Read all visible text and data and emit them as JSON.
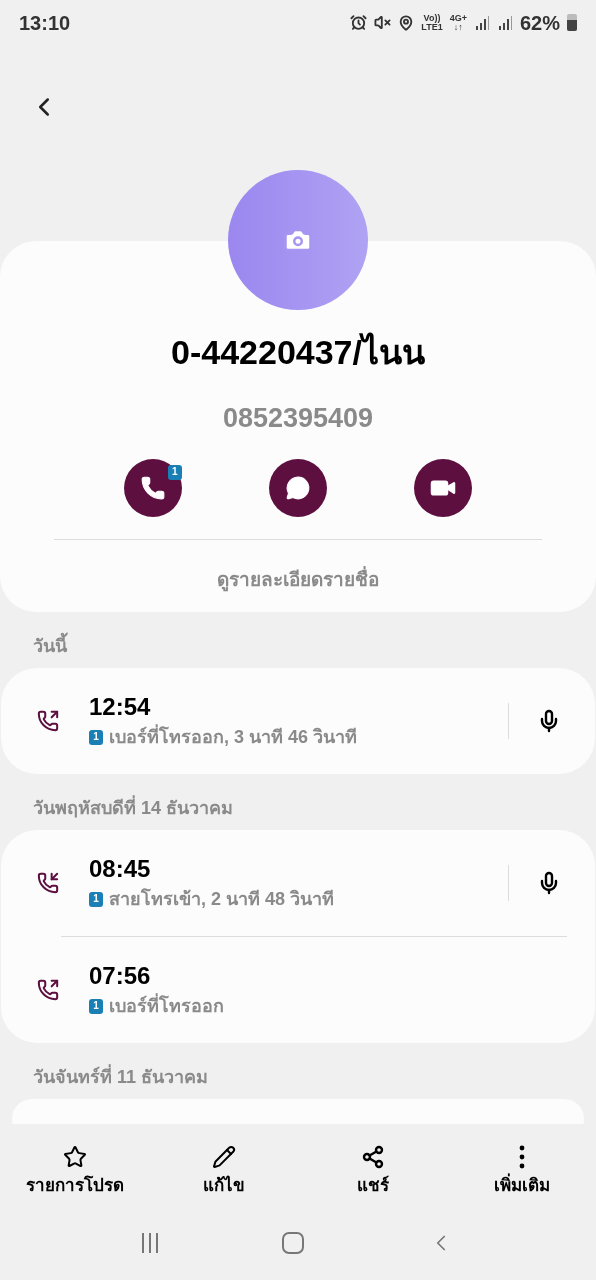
{
  "status_bar": {
    "time": "13:10",
    "volte": "Vo))",
    "lte": "LTE1",
    "network": "4G+",
    "data_arrows": "↓↑",
    "battery": "62%"
  },
  "contact": {
    "name": "0-44220437/ไนน",
    "number": "0852395409",
    "call_sim_badge": "1",
    "details_link": "ดูรายละเอียดรายชื่อ"
  },
  "groups": [
    {
      "date": "วันนี้",
      "calls": [
        {
          "kind": "outgoing",
          "time": "12:54",
          "sim": "1",
          "detail": "เบอร์ที่โทรออก, 3 นาที 46 วินาที",
          "recording": true
        }
      ]
    },
    {
      "date": "วันพฤหัสบดีที่ 14 ธันวาคม",
      "calls": [
        {
          "kind": "incoming",
          "time": "08:45",
          "sim": "1",
          "detail": "สายโทรเข้า, 2 นาที 48 วินาที",
          "recording": true
        },
        {
          "kind": "outgoing",
          "time": "07:56",
          "sim": "1",
          "detail": "เบอร์ที่โทรออก",
          "recording": false
        }
      ]
    },
    {
      "date": "วันจันทร์ที่ 11 ธันวาคม"
    }
  ],
  "bottom_actions": [
    {
      "kind": "favorite",
      "label": "รายการโปรด"
    },
    {
      "kind": "edit",
      "label": "แก้ไข"
    },
    {
      "kind": "share",
      "label": "แชร์"
    },
    {
      "kind": "more",
      "label": "เพิ่มเติม"
    }
  ]
}
